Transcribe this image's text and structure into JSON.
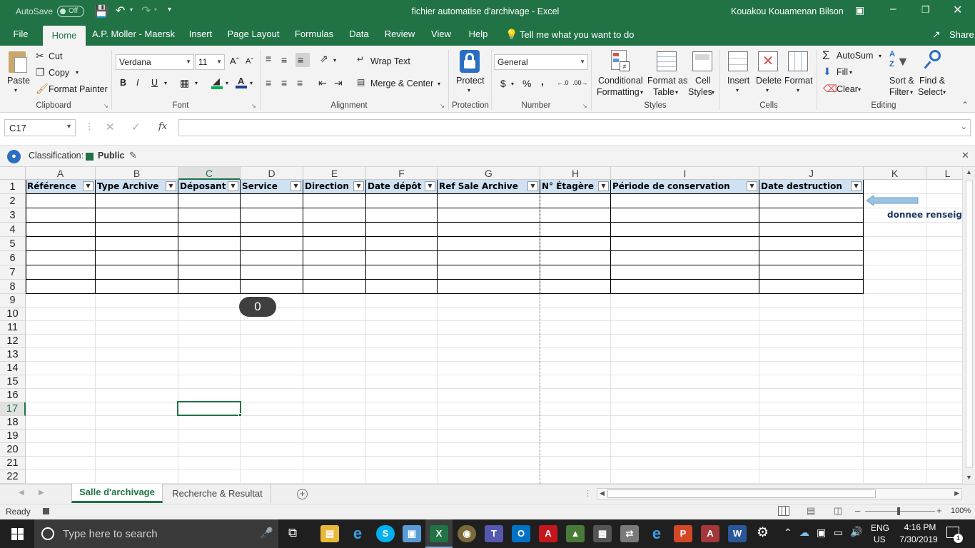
{
  "titlebar": {
    "autosave_label": "AutoSave",
    "autosave_state": "Off",
    "document_title": "fichier automatise d'archivage  -  Excel",
    "user_name": "Kouakou Kouamenan Bilson"
  },
  "tabs": [
    "File",
    "Home",
    "A.P. Moller - Maersk",
    "Insert",
    "Page Layout",
    "Formulas",
    "Data",
    "Review",
    "View",
    "Help"
  ],
  "tell_me": "Tell me what you want to do",
  "share_label": "Share",
  "ribbon": {
    "clipboard": {
      "paste": "Paste",
      "cut": "Cut",
      "copy": "Copy",
      "format_painter": "Format Painter",
      "group": "Clipboard"
    },
    "font": {
      "font_name": "Verdana",
      "font_size": "11",
      "bold": "B",
      "italic": "I",
      "underline": "U",
      "group": "Font"
    },
    "alignment": {
      "wrap_text": "Wrap Text",
      "merge_center": "Merge & Center",
      "group": "Alignment"
    },
    "protection": {
      "protect": "Protect",
      "group": "Protection"
    },
    "number": {
      "format": "General",
      "currency": "$",
      "percent": "%",
      "comma": ",",
      "group": "Number"
    },
    "styles": {
      "conditional_1": "Conditional",
      "conditional_2": "Formatting",
      "format_table_1": "Format as",
      "format_table_2": "Table",
      "cell_styles_1": "Cell",
      "cell_styles_2": "Styles",
      "group": "Styles"
    },
    "cells": {
      "insert": "Insert",
      "delete": "Delete",
      "format": "Format",
      "group": "Cells"
    },
    "editing": {
      "autosum": "AutoSum",
      "fill": "Fill",
      "clear": "Clear",
      "sort_1": "Sort &",
      "sort_2": "Filter",
      "find_1": "Find &",
      "find_2": "Select",
      "group": "Editing"
    }
  },
  "formula_bar": {
    "name_box": "C17",
    "fx": "fx",
    "formula": ""
  },
  "classification": {
    "label": "Classification:",
    "value": "Public",
    "color": "#217346"
  },
  "grid": {
    "columns": [
      "A",
      "B",
      "C",
      "D",
      "E",
      "F",
      "G",
      "H",
      "I",
      "J",
      "K",
      "L"
    ],
    "rows": [
      "1",
      "2",
      "3",
      "4",
      "5",
      "6",
      "7",
      "8",
      "9",
      "10",
      "11",
      "12",
      "13",
      "14",
      "15",
      "16",
      "17",
      "18",
      "19",
      "20",
      "21",
      "22"
    ],
    "selected_cell": "C17",
    "headers": [
      "Référence",
      "Type Archive",
      "Déposant",
      "Service",
      "Direction",
      "Date dépôt",
      "Ref Sale Archive",
      "N° Étagère",
      "Période de conservation",
      "Date destruction"
    ],
    "shape_value": "0",
    "note_text": "donnee renseign",
    "header_fill": "#cfe2f3"
  },
  "sheet_tabs": [
    "Salle d'archivage",
    "Recherche & Resultat"
  ],
  "status": {
    "ready": "Ready",
    "zoom": "100%"
  },
  "taskbar": {
    "search_placeholder": "Type here to search",
    "lang_1": "ENG",
    "lang_2": "US",
    "time": "4:16 PM",
    "date": "7/30/2019",
    "notif_count": "1"
  }
}
